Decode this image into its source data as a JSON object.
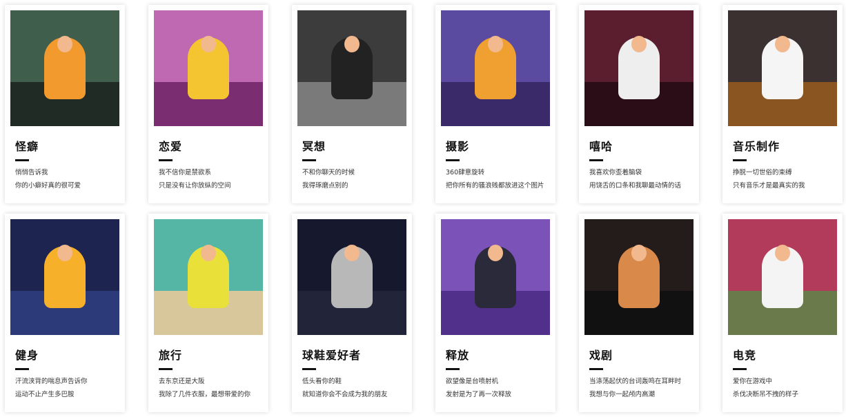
{
  "cards": [
    {
      "title": "怪癖",
      "line1": "悄悄告诉我",
      "line2": "你的小癖好真的很可爱",
      "bg": "#3f5e4c",
      "ground": "#1f2b24",
      "fig": "#f29a2e"
    },
    {
      "title": "恋爱",
      "line1": "我不信你是禁欲系",
      "line2": "只是没有让你放纵的空间",
      "bg": "#c069b3",
      "ground": "#7a2d70",
      "fig": "#f5c531"
    },
    {
      "title": "冥想",
      "line1": "不和你聊天的时候",
      "line2": "我得琢磨点别的",
      "bg": "#3c3c3c",
      "ground": "#7a7a7a",
      "fig": "#222222"
    },
    {
      "title": "摄影",
      "line1": "360肆意旋转",
      "line2": "把你所有的骚浪贱都放进这个图片",
      "bg": "#5a4aa0",
      "ground": "#3a2a6a",
      "fig": "#f0a030"
    },
    {
      "title": "嘻哈",
      "line1": "我喜欢你歪着脑袋",
      "line2": "用饶舌的口条和我聊最动情的话",
      "bg": "#5a1e2e",
      "ground": "#2a0d16",
      "fig": "#eeeeee"
    },
    {
      "title": "音乐制作",
      "line1": "挣脱一切世俗的束缚",
      "line2": "只有音乐才是最真实的我",
      "bg": "#3a3130",
      "ground": "#8a5520",
      "fig": "#f5f5f5"
    },
    {
      "title": "健身",
      "line1": "汗流浃背的喘息声告诉你",
      "line2": "运动不止产生多巴胺",
      "bg": "#1e2450",
      "ground": "#2d3a7a",
      "fig": "#f7b02a"
    },
    {
      "title": "旅行",
      "line1": "去东京还是大阪",
      "line2": "我除了几件衣服，最想带爱的你",
      "bg": "#56b6a6",
      "ground": "#d8c79a",
      "fig": "#e9e03a"
    },
    {
      "title": "球鞋爱好者",
      "line1": "低头看你的鞋",
      "line2": "就知道你会不会成为我的朋友",
      "bg": "#16182e",
      "ground": "#22253a",
      "fig": "#b8b8b8"
    },
    {
      "title": "释放",
      "line1": "欲望像是台喷射机",
      "line2": "发射是为了再一次释放",
      "bg": "#7a52b8",
      "ground": "#50308a",
      "fig": "#2a2a3a"
    },
    {
      "title": "戏剧",
      "line1": "当涤荡起伏的台词轰鸣在耳畔时",
      "line2": "我想与你一起颅内高潮",
      "bg": "#241c1a",
      "ground": "#111111",
      "fig": "#d98a4a"
    },
    {
      "title": "电竞",
      "line1": "爱你在游戏中",
      "line2": "杀伐决断吊不拽的样子",
      "bg": "#b23a5a",
      "ground": "#6a7a4a",
      "fig": "#f4f4f4"
    }
  ]
}
